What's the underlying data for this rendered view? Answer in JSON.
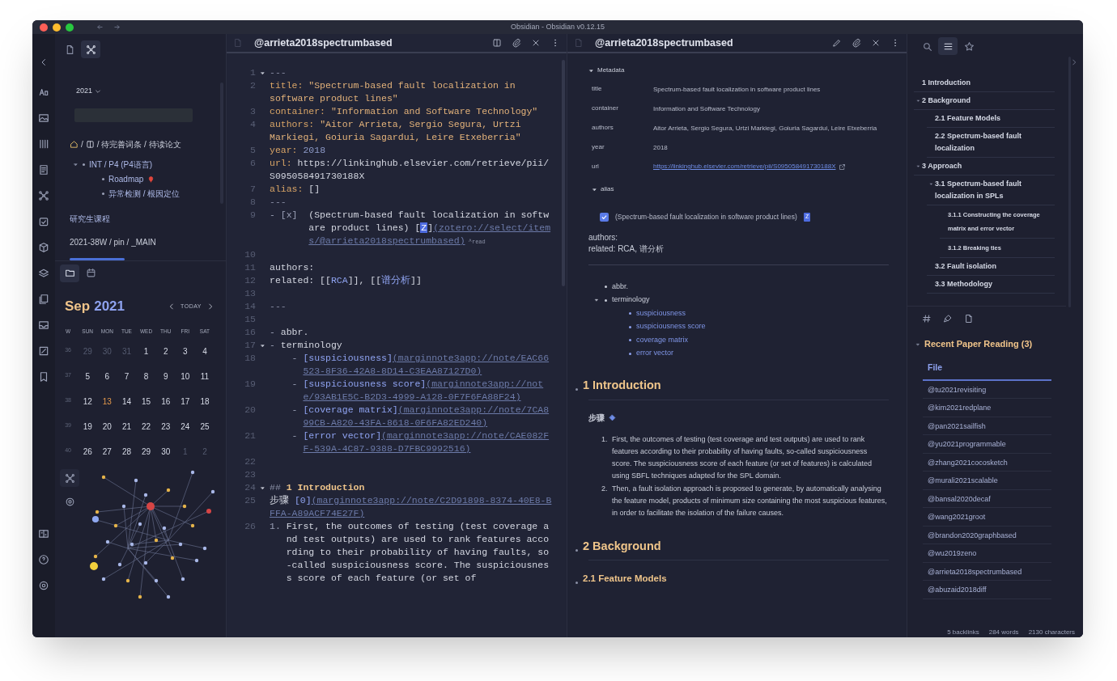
{
  "window": {
    "title": "Obsidian - Obsidian v0.12.15"
  },
  "left_sidebar": {
    "top_tabs": [
      {
        "selected": false
      },
      {
        "selected": true
      }
    ],
    "year_dropdown": "2021",
    "breadcrumb": [
      "/",
      "/ 待完善词条 / 待读论文"
    ],
    "tree": [
      {
        "label": "INT / P4 (P4语言)",
        "pin": false,
        "children": [
          {
            "label": "Roadmap",
            "pin": true
          },
          {
            "label": "异常检测 / 根因定位",
            "pin": false
          }
        ]
      }
    ],
    "links": [
      "研究生课程",
      "2021-38W / pin / _MAIN"
    ],
    "bottom_tabs": [
      {
        "selected": true
      },
      {
        "selected": false
      }
    ],
    "calendar": {
      "month": "Sep",
      "year": "2021",
      "today_button": "TODAY",
      "weekdays": [
        "W",
        "SUN",
        "MON",
        "TUE",
        "WED",
        "THU",
        "FRI",
        "SAT"
      ],
      "weeks": [
        {
          "week": "36",
          "days": [
            {
              "day": "29",
              "outside": true,
              "today": false
            },
            {
              "day": "30",
              "outside": true,
              "today": false
            },
            {
              "day": "31",
              "outside": true,
              "today": false
            },
            {
              "day": "1",
              "outside": false,
              "today": false
            },
            {
              "day": "2",
              "outside": false,
              "today": false
            },
            {
              "day": "3",
              "outside": false,
              "today": false
            },
            {
              "day": "4",
              "outside": false,
              "today": false
            }
          ]
        },
        {
          "week": "37",
          "days": [
            {
              "day": "5",
              "outside": false,
              "today": false
            },
            {
              "day": "6",
              "outside": false,
              "today": false
            },
            {
              "day": "7",
              "outside": false,
              "today": false
            },
            {
              "day": "8",
              "outside": false,
              "today": false
            },
            {
              "day": "9",
              "outside": false,
              "today": false
            },
            {
              "day": "10",
              "outside": false,
              "today": false
            },
            {
              "day": "11",
              "outside": false,
              "today": false
            }
          ]
        },
        {
          "week": "38",
          "days": [
            {
              "day": "12",
              "outside": false,
              "today": false
            },
            {
              "day": "13",
              "outside": false,
              "today": true
            },
            {
              "day": "14",
              "outside": false,
              "today": false
            },
            {
              "day": "15",
              "outside": false,
              "today": false
            },
            {
              "day": "16",
              "outside": false,
              "today": false
            },
            {
              "day": "17",
              "outside": false,
              "today": false
            },
            {
              "day": "18",
              "outside": false,
              "today": false
            }
          ]
        },
        {
          "week": "39",
          "days": [
            {
              "day": "19",
              "outside": false,
              "today": false
            },
            {
              "day": "20",
              "outside": false,
              "today": false
            },
            {
              "day": "21",
              "outside": false,
              "today": false
            },
            {
              "day": "22",
              "outside": false,
              "today": false
            },
            {
              "day": "23",
              "outside": false,
              "today": false
            },
            {
              "day": "24",
              "outside": false,
              "today": false
            },
            {
              "day": "25",
              "outside": false,
              "today": false
            }
          ]
        },
        {
          "week": "40",
          "days": [
            {
              "day": "26",
              "outside": false,
              "today": false
            },
            {
              "day": "27",
              "outside": false,
              "today": false
            },
            {
              "day": "28",
              "outside": false,
              "today": false
            },
            {
              "day": "29",
              "outside": false,
              "today": false
            },
            {
              "day": "30",
              "outside": false,
              "today": false
            },
            {
              "day": "1",
              "outside": true,
              "today": false
            },
            {
              "day": "2",
              "outside": true,
              "today": false
            }
          ]
        }
      ]
    }
  },
  "editor": {
    "title": "@arrieta2018spectrumbased",
    "lines": [
      {
        "n": "1",
        "fold": true,
        "parts": [
          {
            "kind": "dim",
            "text": "---"
          }
        ]
      },
      {
        "n": "2",
        "fold": false,
        "parts": [
          {
            "kind": "key",
            "text": "title: "
          },
          {
            "kind": "string",
            "text": "\"Spectrum-based fault localization in software product lines\""
          }
        ]
      },
      {
        "n": "3",
        "fold": false,
        "parts": [
          {
            "kind": "key",
            "text": "container: "
          },
          {
            "kind": "string",
            "text": "\"Information and Software Technology\""
          }
        ]
      },
      {
        "n": "4",
        "fold": false,
        "parts": [
          {
            "kind": "key",
            "text": "authors: "
          },
          {
            "kind": "string",
            "text": "\"Aitor Arrieta, Sergio Segura, Urtzi Markiegi, Goiuria Sagardui, Leire Etxeberria\""
          }
        ]
      },
      {
        "n": "5",
        "fold": false,
        "parts": [
          {
            "kind": "key",
            "text": "year: "
          },
          {
            "kind": "num",
            "text": "2018"
          }
        ]
      },
      {
        "n": "6",
        "fold": false,
        "parts": [
          {
            "kind": "key",
            "text": "url: "
          },
          {
            "kind": "plain",
            "text": "https://linkinghub.elsevier.com/retrieve/pii/S095058491730188X"
          }
        ]
      },
      {
        "n": "7",
        "fold": false,
        "parts": [
          {
            "kind": "key",
            "text": "alias: "
          },
          {
            "kind": "plain",
            "text": "[]"
          }
        ]
      },
      {
        "n": "8",
        "fold": false,
        "parts": [
          {
            "kind": "dim",
            "text": "---"
          }
        ]
      },
      {
        "n": "9",
        "fold": false,
        "parts": [
          {
            "kind": "marker",
            "text": "- [x]  "
          },
          {
            "kind": "plain",
            "text": "(Spectrum-based fault localization in software product lines) ["
          },
          {
            "kind": "badge",
            "text": "Z"
          },
          {
            "kind": "plain",
            "text": "]"
          },
          {
            "kind": "url",
            "text": "(zotero://select/items/@arrieta2018spectrumbased)"
          },
          {
            "kind": "sup",
            "text": " ^read"
          }
        ]
      },
      {
        "n": "10",
        "fold": false
      },
      {
        "n": "11",
        "fold": false,
        "parts": [
          {
            "kind": "plain",
            "text": "authors:"
          }
        ]
      },
      {
        "n": "12",
        "fold": false,
        "parts": [
          {
            "kind": "plain",
            "text": "related: [["
          },
          {
            "kind": "link",
            "text": "RCA"
          },
          {
            "kind": "plain",
            "text": "]], [["
          },
          {
            "kind": "link",
            "text": "谱分析"
          },
          {
            "kind": "plain",
            "text": "]]"
          }
        ]
      },
      {
        "n": "13",
        "fold": false
      },
      {
        "n": "14",
        "fold": false,
        "parts": [
          {
            "kind": "dim",
            "text": "---"
          }
        ]
      },
      {
        "n": "15",
        "fold": false
      },
      {
        "n": "16",
        "fold": false,
        "parts": [
          {
            "kind": "marker",
            "text": "- "
          },
          {
            "kind": "plain",
            "text": "abbr."
          }
        ]
      },
      {
        "n": "17",
        "fold": true,
        "parts": [
          {
            "kind": "marker",
            "text": "- "
          },
          {
            "kind": "plain",
            "text": "terminology"
          }
        ]
      },
      {
        "n": "18",
        "fold": false,
        "parts": [
          {
            "kind": "marker",
            "text": "    - "
          },
          {
            "kind": "link",
            "text": "[suspiciousness]"
          },
          {
            "kind": "url",
            "text": "(marginnote3app://note/EAC66523-8F36-42A8-8D14-C3EAA87127D0)"
          }
        ]
      },
      {
        "n": "19",
        "fold": false,
        "parts": [
          {
            "kind": "marker",
            "text": "    - "
          },
          {
            "kind": "link",
            "text": "[suspiciousness score]"
          },
          {
            "kind": "url",
            "text": "(marginnote3app://note/93AB1E5C-B2D3-4999-A128-0F7F6FA88F24)"
          }
        ]
      },
      {
        "n": "20",
        "fold": false,
        "parts": [
          {
            "kind": "marker",
            "text": "    - "
          },
          {
            "kind": "link",
            "text": "[coverage matrix]"
          },
          {
            "kind": "url",
            "text": "(marginnote3app://note/7CA899CB-A820-43FA-8618-0F6FA82ED240)"
          }
        ]
      },
      {
        "n": "21",
        "fold": false,
        "parts": [
          {
            "kind": "marker",
            "text": "    - "
          },
          {
            "kind": "link",
            "text": "[error vector]"
          },
          {
            "kind": "url",
            "text": "(marginnote3app://note/CAE082FF-539A-4C87-9388-D7FBC9992516)"
          }
        ]
      },
      {
        "n": "22",
        "fold": false
      },
      {
        "n": "23",
        "fold": false
      },
      {
        "n": "24",
        "fold": true,
        "parts": [
          {
            "kind": "dim",
            "text": "## "
          },
          {
            "kind": "heading",
            "text": "1 Introduction"
          }
        ]
      },
      {
        "n": "25",
        "fold": false,
        "parts": [
          {
            "kind": "plain",
            "text": "步骤 "
          },
          {
            "kind": "link",
            "text": "[0]"
          },
          {
            "kind": "url",
            "text": "(marginnote3app://note/C2D91898-8374-40E8-BFFA-A89ACF74E27F)"
          }
        ]
      },
      {
        "n": "26",
        "fold": false,
        "parts": [
          {
            "kind": "marker",
            "text": "1. "
          },
          {
            "kind": "plain",
            "text": "First, the outcomes of testing (test coverage and test outputs) are used to rank features according to their probability of having faults, so-called suspiciousness score. The suspiciousness score of each feature (or set of"
          }
        ]
      }
    ]
  },
  "preview": {
    "title": "@arrieta2018spectrumbased",
    "metadata": {
      "label": "Metadata",
      "expanded": true,
      "rows": [
        {
          "key": "title",
          "value": "Spectrum-based fault localization in software product lines",
          "kind": "text"
        },
        {
          "key": "container",
          "value": "Information and Software Technology",
          "kind": "text"
        },
        {
          "key": "authors",
          "value": "Aitor Arrieta, Sergio Segura, Urtzi Markiegi, Goiuria Sagardui, Leire Etxeberria",
          "kind": "text"
        },
        {
          "key": "year",
          "value": "2018",
          "kind": "text"
        },
        {
          "key": "url",
          "value": "https://linkinghub.elsevier.com/retrieve/pii/S095058491730188X",
          "kind": "link"
        }
      ]
    },
    "alias": {
      "label": "alias",
      "expanded": true,
      "items": [
        {
          "text": "(Spectrum-based fault localization in software product lines)",
          "checked": true,
          "badge": "Z"
        }
      ]
    },
    "fields": [
      "authors:",
      "related: RCA, 谱分析"
    ],
    "bullets": [
      {
        "text": "abbr."
      },
      {
        "text": "terminology",
        "children": [
          {
            "text": "suspiciousness"
          },
          {
            "text": "suspiciousness score"
          },
          {
            "text": "coverage matrix"
          },
          {
            "text": "error vector"
          }
        ]
      }
    ],
    "sections": [
      {
        "kind": "h2",
        "text": "1 Introduction"
      },
      {
        "kind": "steps",
        "text": "步骤"
      },
      {
        "kind": "ol",
        "items": [
          {
            "num": "1.",
            "text": "First, the outcomes of testing (test coverage and test outputs) are used to rank features according to their probability of having faults, so-called suspiciousness score. The suspiciousness score of each feature (or set of features) is calculated using SBFL techniques adapted for the SPL domain."
          },
          {
            "num": "2.",
            "text": "Then, a fault isolation approach is proposed to generate, by automatically analysing the feature model, products of minimum size containing the most suspicious features, in order to facilitate the isolation of the failure causes."
          }
        ]
      },
      {
        "kind": "h2",
        "text": "2 Background"
      },
      {
        "kind": "h3",
        "text": "2.1 Feature Models"
      }
    ]
  },
  "right_sidebar": {
    "tabs": [
      {
        "selected": false
      },
      {
        "selected": true
      },
      {
        "selected": false
      }
    ],
    "outline": [
      {
        "text": "1 Introduction"
      },
      {
        "text": "2 Background",
        "children": [
          {
            "text": "2.1 Feature Models"
          },
          {
            "text": "2.2 Spectrum-based fault localization"
          }
        ]
      },
      {
        "text": "3 Approach",
        "children": [
          {
            "text": "3.1 Spectrum-based fault localization in SPLs",
            "children": [
              {
                "text": "3.1.1 Constructing the coverage matrix and error vector"
              },
              {
                "text": "3.1.2 Breaking ties"
              }
            ]
          },
          {
            "text": "3.2 Fault isolation"
          },
          {
            "text": "3.3 Methodology"
          }
        ]
      }
    ],
    "recent": {
      "title": "Recent Paper Reading (3)",
      "expanded": true,
      "column": "File",
      "rows": [
        "@tu2021revisiting",
        "@kim2021redplane",
        "@pan2021sailfish",
        "@yu2021programmable",
        "@zhang2021cocosketch",
        "@murali2021scalable",
        "@bansal2020decaf",
        "@wang2021groot",
        "@brandon2020graphbased",
        "@wu2019zeno",
        "@arrieta2018spectrumbased",
        "@abuzaid2018diff"
      ]
    }
  },
  "status_bar": [
    "5 backlinks",
    "284 words",
    "2130 characters"
  ]
}
